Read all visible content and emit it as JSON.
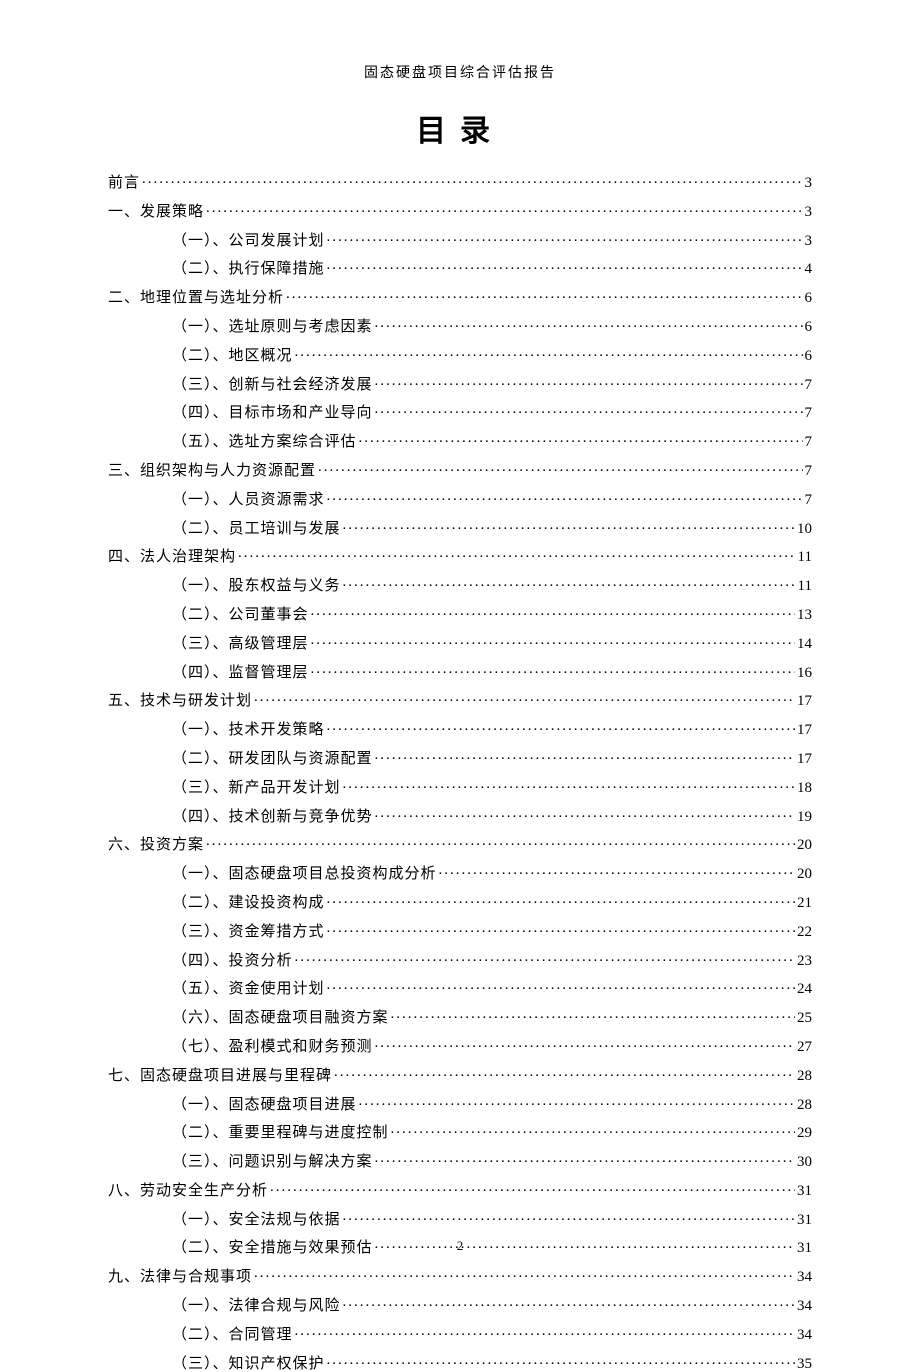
{
  "header": "固态硬盘项目综合评估报告",
  "title": "目录",
  "page_number": "2",
  "toc": [
    {
      "label": "前言",
      "page": "3",
      "level": 0
    },
    {
      "label": "一、发展策略",
      "page": "3",
      "level": 0
    },
    {
      "label": "（一）、公司发展计划",
      "page": "3",
      "level": 1
    },
    {
      "label": "（二）、执行保障措施",
      "page": "4",
      "level": 1
    },
    {
      "label": "二、地理位置与选址分析",
      "page": "6",
      "level": 0
    },
    {
      "label": "（一）、选址原则与考虑因素",
      "page": "6",
      "level": 1
    },
    {
      "label": "（二）、地区概况",
      "page": "6",
      "level": 1
    },
    {
      "label": "（三）、创新与社会经济发展",
      "page": "7",
      "level": 1
    },
    {
      "label": "（四）、目标市场和产业导向",
      "page": "7",
      "level": 1
    },
    {
      "label": "（五）、选址方案综合评估",
      "page": "7",
      "level": 1
    },
    {
      "label": "三、组织架构与人力资源配置",
      "page": "7",
      "level": 0
    },
    {
      "label": "（一）、人员资源需求",
      "page": "7",
      "level": 1
    },
    {
      "label": "（二）、员工培训与发展",
      "page": "10",
      "level": 1
    },
    {
      "label": "四、法人治理架构",
      "page": "11",
      "level": 0
    },
    {
      "label": "（一）、股东权益与义务",
      "page": "11",
      "level": 1
    },
    {
      "label": "（二）、公司董事会",
      "page": "13",
      "level": 1
    },
    {
      "label": "（三）、高级管理层",
      "page": "14",
      "level": 1
    },
    {
      "label": "（四）、监督管理层",
      "page": "16",
      "level": 1
    },
    {
      "label": "五、技术与研发计划",
      "page": "17",
      "level": 0
    },
    {
      "label": "（一）、技术开发策略",
      "page": "17",
      "level": 1
    },
    {
      "label": "（二）、研发团队与资源配置",
      "page": "17",
      "level": 1
    },
    {
      "label": "（三）、新产品开发计划",
      "page": "18",
      "level": 1
    },
    {
      "label": "（四）、技术创新与竞争优势",
      "page": "19",
      "level": 1
    },
    {
      "label": "六、投资方案",
      "page": "20",
      "level": 0
    },
    {
      "label": "（一）、固态硬盘项目总投资构成分析",
      "page": "20",
      "level": 1
    },
    {
      "label": "（二）、建设投资构成",
      "page": "21",
      "level": 1
    },
    {
      "label": "（三）、资金筹措方式",
      "page": "22",
      "level": 1
    },
    {
      "label": "（四）、投资分析",
      "page": "23",
      "level": 1
    },
    {
      "label": "（五）、资金使用计划",
      "page": "24",
      "level": 1
    },
    {
      "label": "（六）、固态硬盘项目融资方案",
      "page": "25",
      "level": 1
    },
    {
      "label": "（七）、盈利模式和财务预测",
      "page": "27",
      "level": 1
    },
    {
      "label": "七、固态硬盘项目进展与里程碑",
      "page": "28",
      "level": 0
    },
    {
      "label": "（一）、固态硬盘项目进展",
      "page": "28",
      "level": 1
    },
    {
      "label": "（二）、重要里程碑与进度控制",
      "page": "29",
      "level": 1
    },
    {
      "label": "（三）、问题识别与解决方案",
      "page": "30",
      "level": 1
    },
    {
      "label": "八、劳动安全生产分析",
      "page": "31",
      "level": 0
    },
    {
      "label": "（一）、安全法规与依据",
      "page": "31",
      "level": 1
    },
    {
      "label": "（二）、安全措施与效果预估",
      "page": "31",
      "level": 1
    },
    {
      "label": "九、法律与合规事项",
      "page": "34",
      "level": 0
    },
    {
      "label": "（一）、法律合规与风险",
      "page": "34",
      "level": 1
    },
    {
      "label": "（二）、合同管理",
      "page": "34",
      "level": 1
    },
    {
      "label": "（三）、知识产权保护",
      "page": "35",
      "level": 1
    }
  ]
}
